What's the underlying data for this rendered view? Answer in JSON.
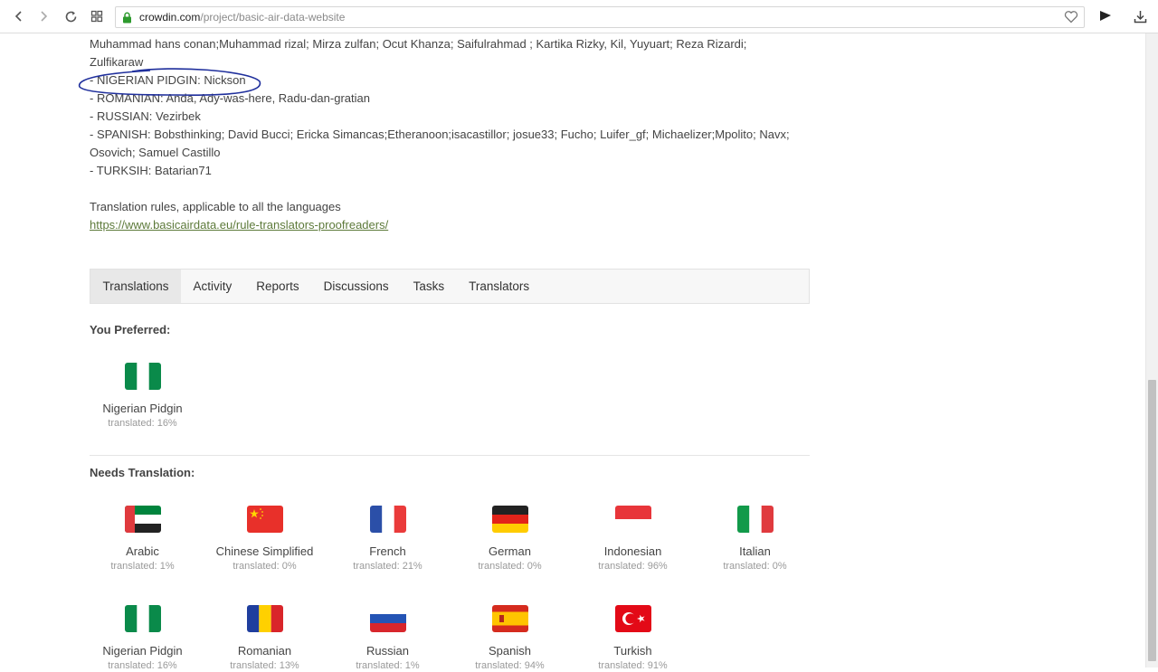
{
  "browser": {
    "url_host": "crowdin.com",
    "url_path": "/project/basic-air-data-website"
  },
  "credits": [
    "Muhammad hans conan;Muhammad rizal; Mirza zulfan; Ocut Khanza; Saifulrahmad ; Kartika Rizky, Kil, Yuyuart; Reza Rizardi;",
    "Zulfikaraw",
    "- NIGERIAN PIDGIN: Nickson",
    "- ROMANIAN: Anda, Ady-was-here, Radu-dan-gratian",
    "- RUSSIAN: Vezirbek",
    "- SPANISH: Bobsthinking; David Bucci; Ericka Simancas;Etheranoon;isacastillor; josue33; Fucho; Luifer_gf; Michaelizer;Mpolito; Navx;",
    "Osovich; Samuel Castillo",
    "- TURKSIH: Batarian71"
  ],
  "rules": {
    "text": "Translation rules, applicable to all the languages",
    "link": "https://www.basicairdata.eu/rule-translators-proofreaders/"
  },
  "tabs": [
    "Translations",
    "Activity",
    "Reports",
    "Discussions",
    "Tasks",
    "Translators"
  ],
  "preferred": {
    "title": "You Preferred:",
    "languages": [
      {
        "name": "Nigerian Pidgin",
        "translated": "translated: 16%",
        "flag": "nigeria"
      }
    ]
  },
  "needs": {
    "title": "Needs Translation:",
    "languages": [
      {
        "name": "Arabic",
        "translated": "translated: 1%",
        "flag": "uae"
      },
      {
        "name": "Chinese Simplified",
        "translated": "translated: 0%",
        "flag": "china"
      },
      {
        "name": "French",
        "translated": "translated: 21%",
        "flag": "france"
      },
      {
        "name": "German",
        "translated": "translated: 0%",
        "flag": "germany"
      },
      {
        "name": "Indonesian",
        "translated": "translated: 96%",
        "flag": "indonesia"
      },
      {
        "name": "Italian",
        "translated": "translated: 0%",
        "flag": "italy"
      },
      {
        "name": "Nigerian Pidgin",
        "translated": "translated: 16%",
        "flag": "nigeria"
      },
      {
        "name": "Romanian",
        "translated": "translated: 13%",
        "flag": "romania"
      },
      {
        "name": "Russian",
        "translated": "translated: 1%",
        "flag": "russia"
      },
      {
        "name": "Spanish",
        "translated": "translated: 94%",
        "flag": "spain"
      },
      {
        "name": "Turkish",
        "translated": "translated: 91%",
        "flag": "turkey"
      }
    ]
  },
  "colors": {
    "link": "#5d7a3a",
    "annotation": "#1f2f9c",
    "tab_active_bg": "#e8e8e8"
  }
}
